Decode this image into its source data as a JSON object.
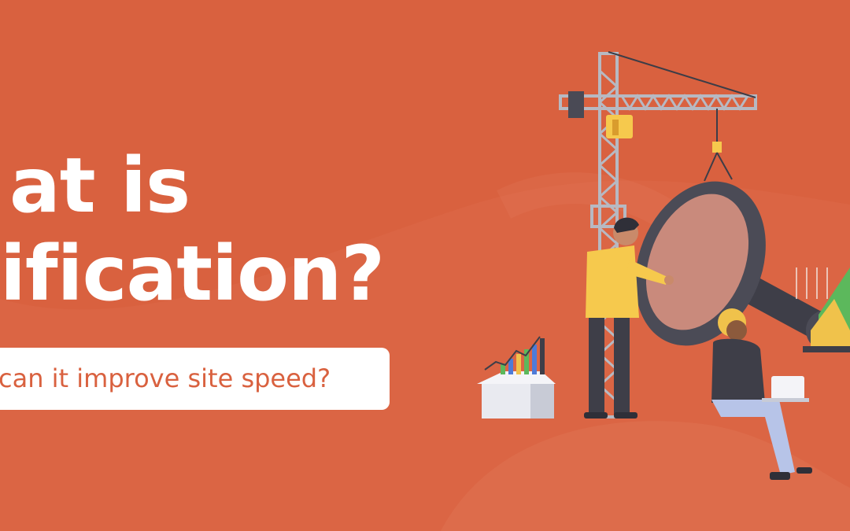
{
  "banner": {
    "title_line_1": "at is",
    "title_line_2": "ification?",
    "subtitle": "can it improve site speed?"
  },
  "colors": {
    "background": "#d9613f",
    "title_text": "#ffffff",
    "subtitle_box": "#ffffff",
    "subtitle_text": "#d9613f"
  },
  "illustration": {
    "elements": [
      "construction-crane",
      "magnifying-glass",
      "standing-man",
      "seated-woman-with-laptop",
      "box-with-bar-chart",
      "green-growth-chart"
    ]
  }
}
